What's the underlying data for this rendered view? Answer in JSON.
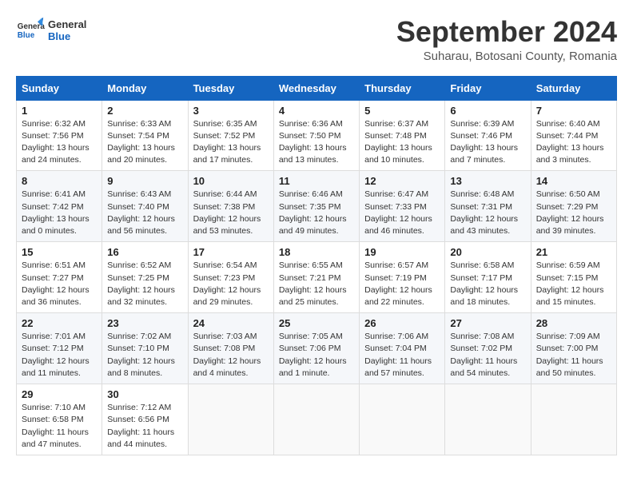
{
  "header": {
    "logo_general": "General",
    "logo_blue": "Blue",
    "month_title": "September 2024",
    "subtitle": "Suharau, Botosani County, Romania"
  },
  "calendar": {
    "days_of_week": [
      "Sunday",
      "Monday",
      "Tuesday",
      "Wednesday",
      "Thursday",
      "Friday",
      "Saturday"
    ],
    "weeks": [
      [
        {
          "day": "1",
          "info": "Sunrise: 6:32 AM\nSunset: 7:56 PM\nDaylight: 13 hours\nand 24 minutes."
        },
        {
          "day": "2",
          "info": "Sunrise: 6:33 AM\nSunset: 7:54 PM\nDaylight: 13 hours\nand 20 minutes."
        },
        {
          "day": "3",
          "info": "Sunrise: 6:35 AM\nSunset: 7:52 PM\nDaylight: 13 hours\nand 17 minutes."
        },
        {
          "day": "4",
          "info": "Sunrise: 6:36 AM\nSunset: 7:50 PM\nDaylight: 13 hours\nand 13 minutes."
        },
        {
          "day": "5",
          "info": "Sunrise: 6:37 AM\nSunset: 7:48 PM\nDaylight: 13 hours\nand 10 minutes."
        },
        {
          "day": "6",
          "info": "Sunrise: 6:39 AM\nSunset: 7:46 PM\nDaylight: 13 hours\nand 7 minutes."
        },
        {
          "day": "7",
          "info": "Sunrise: 6:40 AM\nSunset: 7:44 PM\nDaylight: 13 hours\nand 3 minutes."
        }
      ],
      [
        {
          "day": "8",
          "info": "Sunrise: 6:41 AM\nSunset: 7:42 PM\nDaylight: 13 hours\nand 0 minutes."
        },
        {
          "day": "9",
          "info": "Sunrise: 6:43 AM\nSunset: 7:40 PM\nDaylight: 12 hours\nand 56 minutes."
        },
        {
          "day": "10",
          "info": "Sunrise: 6:44 AM\nSunset: 7:38 PM\nDaylight: 12 hours\nand 53 minutes."
        },
        {
          "day": "11",
          "info": "Sunrise: 6:46 AM\nSunset: 7:35 PM\nDaylight: 12 hours\nand 49 minutes."
        },
        {
          "day": "12",
          "info": "Sunrise: 6:47 AM\nSunset: 7:33 PM\nDaylight: 12 hours\nand 46 minutes."
        },
        {
          "day": "13",
          "info": "Sunrise: 6:48 AM\nSunset: 7:31 PM\nDaylight: 12 hours\nand 43 minutes."
        },
        {
          "day": "14",
          "info": "Sunrise: 6:50 AM\nSunset: 7:29 PM\nDaylight: 12 hours\nand 39 minutes."
        }
      ],
      [
        {
          "day": "15",
          "info": "Sunrise: 6:51 AM\nSunset: 7:27 PM\nDaylight: 12 hours\nand 36 minutes."
        },
        {
          "day": "16",
          "info": "Sunrise: 6:52 AM\nSunset: 7:25 PM\nDaylight: 12 hours\nand 32 minutes."
        },
        {
          "day": "17",
          "info": "Sunrise: 6:54 AM\nSunset: 7:23 PM\nDaylight: 12 hours\nand 29 minutes."
        },
        {
          "day": "18",
          "info": "Sunrise: 6:55 AM\nSunset: 7:21 PM\nDaylight: 12 hours\nand 25 minutes."
        },
        {
          "day": "19",
          "info": "Sunrise: 6:57 AM\nSunset: 7:19 PM\nDaylight: 12 hours\nand 22 minutes."
        },
        {
          "day": "20",
          "info": "Sunrise: 6:58 AM\nSunset: 7:17 PM\nDaylight: 12 hours\nand 18 minutes."
        },
        {
          "day": "21",
          "info": "Sunrise: 6:59 AM\nSunset: 7:15 PM\nDaylight: 12 hours\nand 15 minutes."
        }
      ],
      [
        {
          "day": "22",
          "info": "Sunrise: 7:01 AM\nSunset: 7:12 PM\nDaylight: 12 hours\nand 11 minutes."
        },
        {
          "day": "23",
          "info": "Sunrise: 7:02 AM\nSunset: 7:10 PM\nDaylight: 12 hours\nand 8 minutes."
        },
        {
          "day": "24",
          "info": "Sunrise: 7:03 AM\nSunset: 7:08 PM\nDaylight: 12 hours\nand 4 minutes."
        },
        {
          "day": "25",
          "info": "Sunrise: 7:05 AM\nSunset: 7:06 PM\nDaylight: 12 hours\nand 1 minute."
        },
        {
          "day": "26",
          "info": "Sunrise: 7:06 AM\nSunset: 7:04 PM\nDaylight: 11 hours\nand 57 minutes."
        },
        {
          "day": "27",
          "info": "Sunrise: 7:08 AM\nSunset: 7:02 PM\nDaylight: 11 hours\nand 54 minutes."
        },
        {
          "day": "28",
          "info": "Sunrise: 7:09 AM\nSunset: 7:00 PM\nDaylight: 11 hours\nand 50 minutes."
        }
      ],
      [
        {
          "day": "29",
          "info": "Sunrise: 7:10 AM\nSunset: 6:58 PM\nDaylight: 11 hours\nand 47 minutes."
        },
        {
          "day": "30",
          "info": "Sunrise: 7:12 AM\nSunset: 6:56 PM\nDaylight: 11 hours\nand 44 minutes."
        },
        {
          "day": "",
          "info": ""
        },
        {
          "day": "",
          "info": ""
        },
        {
          "day": "",
          "info": ""
        },
        {
          "day": "",
          "info": ""
        },
        {
          "day": "",
          "info": ""
        }
      ]
    ]
  }
}
